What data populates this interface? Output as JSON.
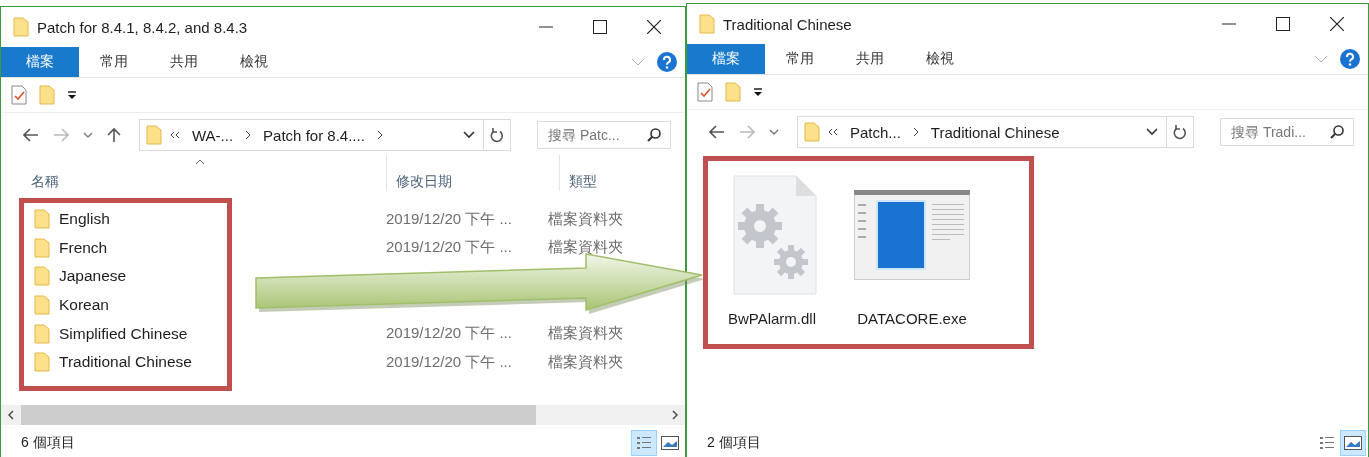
{
  "windows": [
    {
      "kind": "details",
      "title": "Patch for 8.4.1, 8.4.2, and 8.4.3",
      "tabs": [
        {
          "label": "檔案",
          "selected": true
        },
        {
          "label": "常用",
          "selected": false
        },
        {
          "label": "共用",
          "selected": false
        },
        {
          "label": "檢視",
          "selected": false
        }
      ],
      "nav_up": true,
      "breadcrumbs": [
        "WA-...",
        "Patch for 8.4...."
      ],
      "trailing_chevron": true,
      "search": {
        "placeholder": "搜尋 Patc..."
      },
      "columns": [
        "名稱",
        "修改日期",
        "類型"
      ],
      "items": [
        {
          "name": "English",
          "date": "2019/12/20 下午 ...",
          "type": "檔案資料夾"
        },
        {
          "name": "French",
          "date": "2019/12/20 下午 ...",
          "type": "檔案資料夾"
        },
        {
          "name": "Japanese"
        },
        {
          "name": "Korean"
        },
        {
          "name": "Simplified Chinese",
          "date": "2019/12/20 下午 ...",
          "type": "檔案資料夾"
        },
        {
          "name": "Traditional Chinese",
          "date": "2019/12/20 下午 ...",
          "type": "檔案資料夾"
        }
      ],
      "status": "6 個項目",
      "views": [
        {
          "kind": "details",
          "selected": true
        },
        {
          "kind": "large-icons",
          "selected": false
        }
      ]
    },
    {
      "kind": "icons",
      "title": "Traditional Chinese",
      "tabs": [
        {
          "label": "檔案",
          "selected": true
        },
        {
          "label": "常用",
          "selected": false
        },
        {
          "label": "共用",
          "selected": false
        },
        {
          "label": "檢視",
          "selected": false
        }
      ],
      "nav_up": false,
      "breadcrumbs": [
        "Patch...",
        "Traditional Chinese"
      ],
      "trailing_chevron": false,
      "search": {
        "placeholder": "搜尋 Tradi..."
      },
      "items": [
        {
          "name": "BwPAlarm.dll",
          "kind": "dll"
        },
        {
          "name": "DATACORE.exe",
          "kind": "exe"
        }
      ],
      "status": "2 個項目",
      "views": [
        {
          "kind": "details",
          "selected": false
        },
        {
          "kind": "large-icons",
          "selected": true
        }
      ]
    }
  ]
}
